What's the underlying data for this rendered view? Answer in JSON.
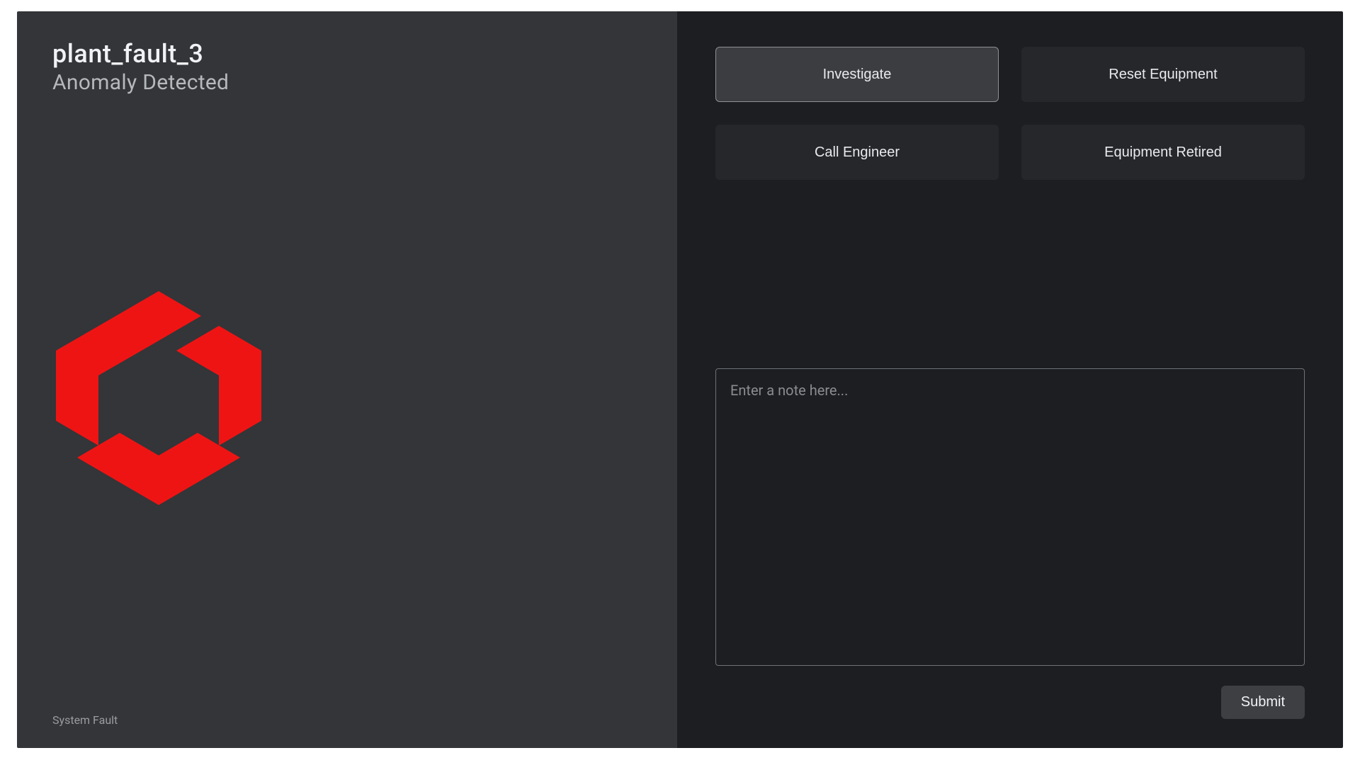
{
  "left": {
    "title": "plant_fault_3",
    "subtitle": "Anomaly Detected",
    "footer": "System Fault"
  },
  "actions": {
    "investigate": "Investigate",
    "reset_equipment": "Reset Equipment",
    "call_engineer": "Call Engineer",
    "equipment_retired": "Equipment Retired"
  },
  "note": {
    "placeholder": "Enter a note here...",
    "value": ""
  },
  "submit_label": "Submit",
  "colors": {
    "logo_red": "#ef1414"
  }
}
